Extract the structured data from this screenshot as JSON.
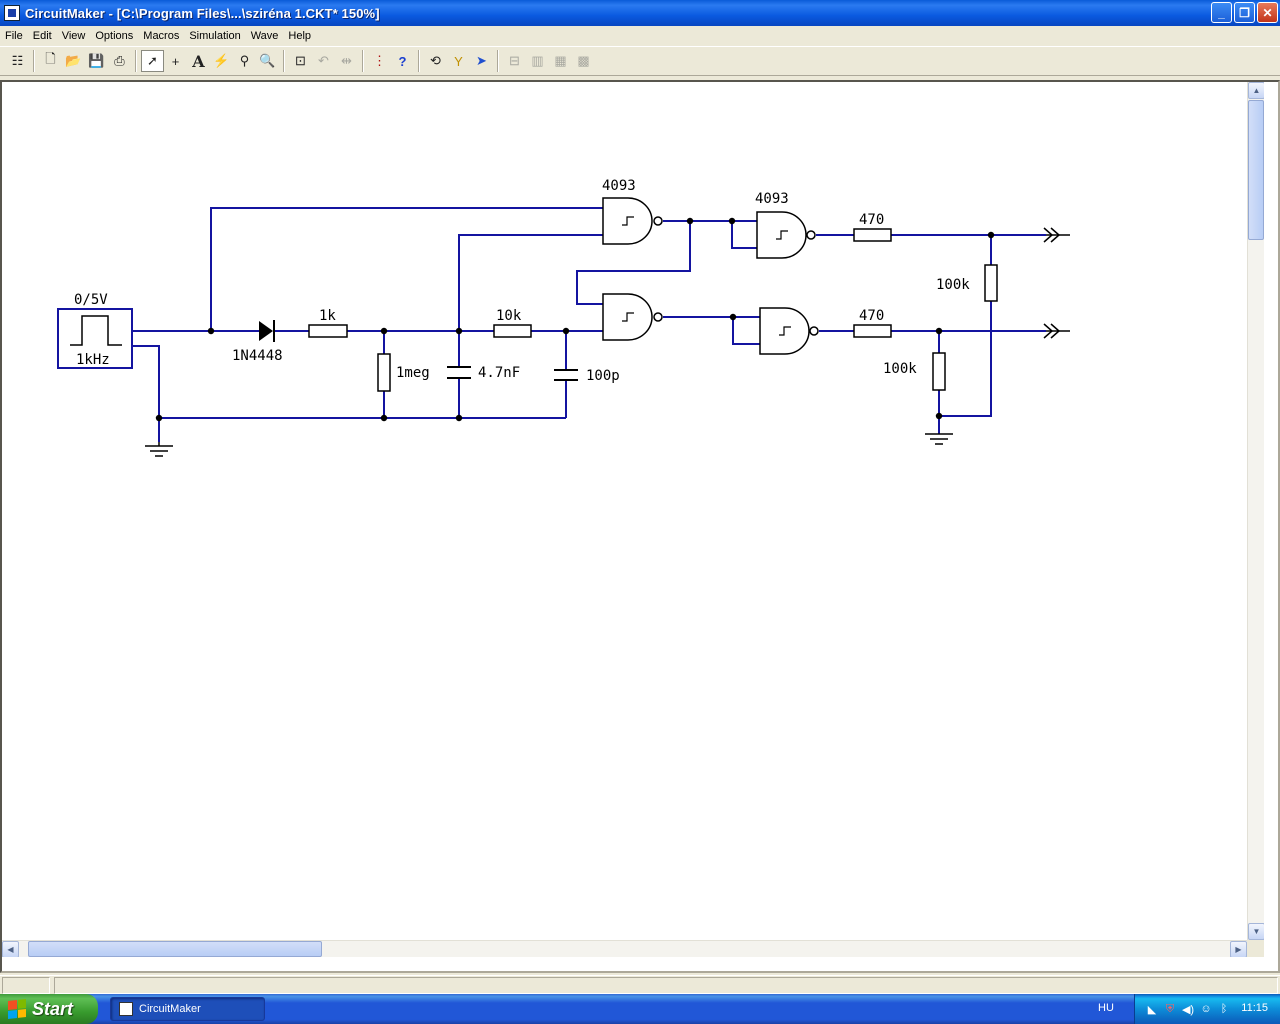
{
  "window": {
    "title": "CircuitMaker - [C:\\Program Files\\...\\sziréna 1.CKT* 150%]",
    "minimize_label": "_",
    "maximize_label": "❐",
    "close_label": "✕"
  },
  "menu": [
    "File",
    "Edit",
    "View",
    "Options",
    "Macros",
    "Simulation",
    "Wave",
    "Help"
  ],
  "toolbar": {
    "icons": [
      "parts-bin-icon",
      "new-icon",
      "open-icon",
      "save-icon",
      "print-icon",
      "arrow-tool-icon",
      "wire-tool-icon",
      "text-tool-icon",
      "probe-tool-icon",
      "delete-tool-icon",
      "zoom-tool-icon",
      "zoom-fit-icon",
      "rotate-icon",
      "mirror-icon",
      "netlist-icon",
      "help-icon",
      "reset-icon",
      "step-icon",
      "run-icon",
      "trace-icon",
      "align-1-icon",
      "align-2-icon",
      "align-3-icon"
    ]
  },
  "schematic": {
    "source_value": "0/5V",
    "source_freq": "1kHz",
    "diode": "1N4448",
    "r_1k": "1k",
    "r_1meg": "1meg",
    "c_47nf": "4.7nF",
    "r_10k": "10k",
    "c_100p": "100p",
    "gate1": "4093",
    "gate2": "4093",
    "r_470_top": "470",
    "r_470_bot": "470",
    "r_100k_top": "100k",
    "r_100k_bot": "100k"
  },
  "taskbar": {
    "start_label": "Start",
    "task_label": "CircuitMaker",
    "language": "HU",
    "clock": "11:15"
  }
}
